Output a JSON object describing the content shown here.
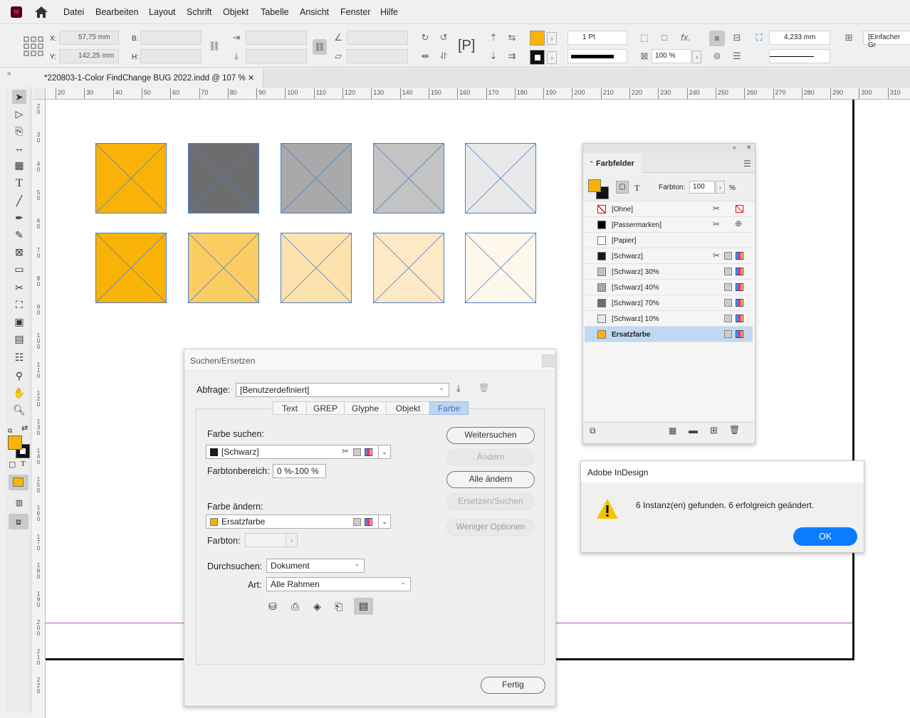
{
  "menu": {
    "items": [
      "Datei",
      "Bearbeiten",
      "Layout",
      "Schrift",
      "Objekt",
      "Tabelle",
      "Ansicht",
      "Fenster",
      "Hilfe"
    ]
  },
  "control": {
    "x_label": "X:",
    "x_value": "57,75 mm",
    "y_label": "Y:",
    "y_value": "142,25 mm",
    "w_label": "B:",
    "h_label": "H:",
    "stroke_weight": "1 Pt",
    "tint_value": "100 %",
    "offset_value": "4,233 mm",
    "style_value": "[Einfacher Gr"
  },
  "document": {
    "tab_title": "*220803-1-Color FindChange BUG 2022.indd @ 107 %",
    "ruler_h": [
      "20",
      "30",
      "40",
      "50",
      "60",
      "70",
      "80",
      "90",
      "100",
      "110",
      "120",
      "130",
      "140",
      "150",
      "160",
      "170",
      "180",
      "190",
      "200",
      "210",
      "220",
      "230",
      "240",
      "250",
      "260",
      "270",
      "280",
      "290",
      "300",
      "310"
    ],
    "ruler_v": [
      "2",
      "3",
      "4",
      "5",
      "6",
      "7",
      "8",
      "9",
      "1\n0\n0",
      "1\n1\n0",
      "1\n2\n0",
      "1\n3\n0",
      "1\n4\n0",
      "1\n5\n0",
      "1\n6\n0",
      "1\n7\n0",
      "1\n8\n0",
      "1\n9\n0",
      "2\n0\n0",
      "2\n1\n0",
      "2\n2\n0"
    ],
    "frame_colors_row1": [
      "#f9b208",
      "#6d6d6d",
      "#a9a9a9",
      "#c3c3c3",
      "#e9e9e9"
    ],
    "frame_colors_row2": [
      "#f9b208",
      "#fbcc62",
      "#fde2ad",
      "#fde9c6",
      "#fef8ec"
    ]
  },
  "swatches": {
    "title": "Farbfelder",
    "tint_label": "Farbton:",
    "tint_value": "100",
    "tint_unit": "%",
    "items": [
      {
        "name": "[Ohne]",
        "color": "none"
      },
      {
        "name": "[Passermarken]",
        "color": "#000000"
      },
      {
        "name": "[Papier]",
        "color": "#ffffff"
      },
      {
        "name": "[Schwarz]",
        "color": "#1a1a1a"
      },
      {
        "name": "[Schwarz] 30%",
        "color": "#c3c3c3"
      },
      {
        "name": "[Schwarz] 40%",
        "color": "#a9a9a9"
      },
      {
        "name": "[Schwarz] 70%",
        "color": "#6d6d6d"
      },
      {
        "name": "[Schwarz] 10%",
        "color": "#e9e9e9"
      },
      {
        "name": "Ersatzfarbe",
        "color": "#f9b208",
        "selected": true
      }
    ]
  },
  "findchange": {
    "title": "Suchen/Ersetzen",
    "query_label": "Abfrage:",
    "query_value": "[Benutzerdefiniert]",
    "tabs": [
      "Text",
      "GREP",
      "Glyphe",
      "Objekt",
      "Farbe"
    ],
    "active_tab": "Farbe",
    "find_label": "Farbe suchen:",
    "find_value": "[Schwarz]",
    "tint_range_label": "Farbtonbereich:",
    "tint_range_value": "0 %-100 %",
    "change_label": "Farbe ändern:",
    "change_value": "Ersatzfarbe",
    "tint_label": "Farbton:",
    "search_label": "Durchsuchen:",
    "search_value": "Dokument",
    "type_label": "Art:",
    "type_value": "Alle Rahmen",
    "btn_find_next": "Weitersuchen",
    "btn_change": "Ändern",
    "btn_change_all": "Alle ändern",
    "btn_change_find": "Ersetzen/Suchen",
    "btn_fewer": "Weniger Optionen",
    "btn_done": "Fertig"
  },
  "alert": {
    "title": "Adobe InDesign",
    "message": "6 Instanz(en) gefunden. 6 erfolgreich geändert.",
    "ok": "OK"
  },
  "colors": {
    "accent": "#0a7cff",
    "fill_swatch": "#f9b208"
  }
}
